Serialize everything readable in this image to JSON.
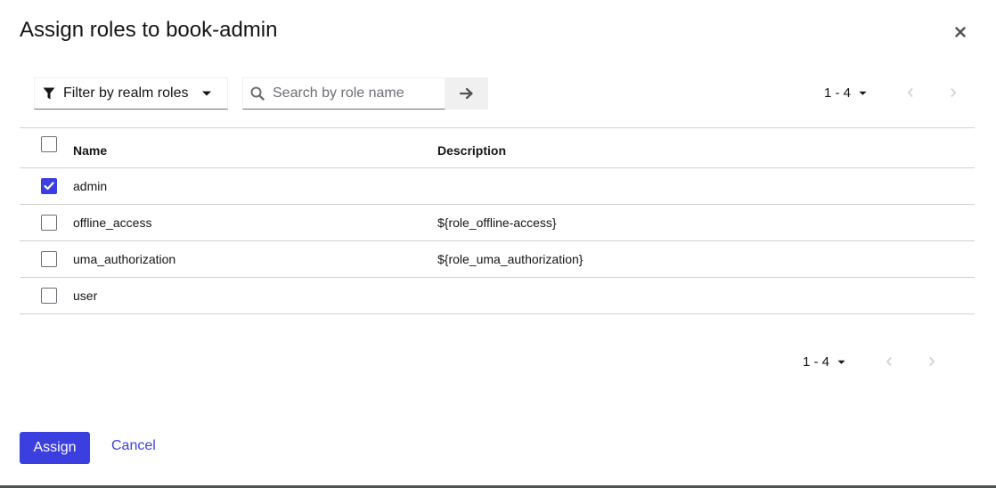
{
  "dialog": {
    "title": "Assign roles to book-admin",
    "close_icon": "close-icon"
  },
  "toolbar": {
    "filter_label": "Filter by realm roles",
    "search_placeholder": "Search by role name",
    "search_value": "",
    "pagination_range": "1 - 4"
  },
  "table": {
    "columns": [
      "Name",
      "Description"
    ],
    "rows": [
      {
        "name": "admin",
        "description": "",
        "checked": true
      },
      {
        "name": "offline_access",
        "description": "${role_offline-access}",
        "checked": false
      },
      {
        "name": "uma_authorization",
        "description": "${role_uma_authorization}",
        "checked": false
      },
      {
        "name": "user",
        "description": "",
        "checked": false
      }
    ],
    "header_checked": false
  },
  "bottom_pagination": {
    "range": "1 - 4"
  },
  "footer": {
    "assign_label": "Assign",
    "cancel_label": "Cancel"
  },
  "colors": {
    "primary": "#3c3fe0",
    "border": "#d2d2d2",
    "disabled": "#d2d2d2"
  }
}
